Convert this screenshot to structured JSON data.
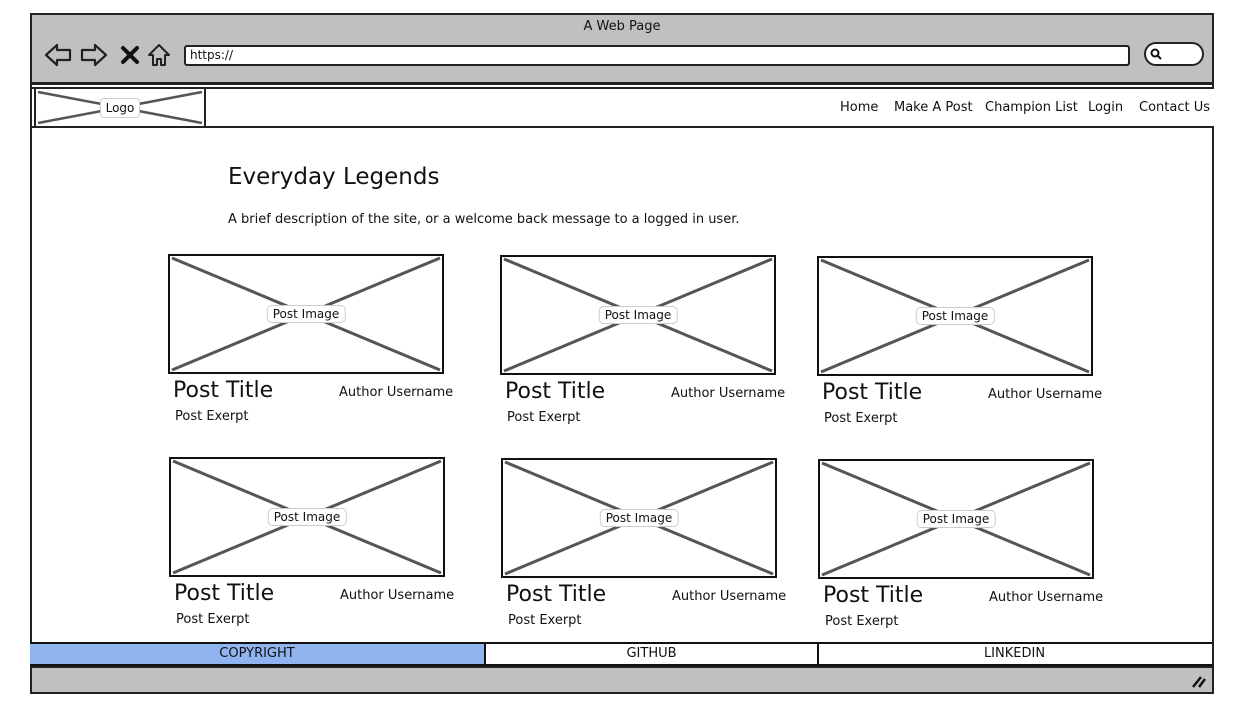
{
  "window": {
    "title": "A Web Page"
  },
  "browser": {
    "back_icon": "back-arrow-icon",
    "forward_icon": "forward-arrow-icon",
    "stop_icon": "close-icon",
    "home_icon": "home-icon",
    "url": "https://",
    "search_icon": "search-icon",
    "chrome_color": "#c0c0c0"
  },
  "header": {
    "logo_label": "Logo",
    "nav": [
      "Home",
      "Make A Post",
      "Champion List",
      "Login",
      "Contact Us"
    ]
  },
  "main": {
    "title": "Everyday Legends",
    "description": "A brief description of the site, or a welcome back message to a logged in user."
  },
  "posts": [
    {
      "image_label": "Post Image",
      "title": "Post Title",
      "author": "Author Username",
      "excerpt": "Post Exerpt"
    },
    {
      "image_label": "Post Image",
      "title": "Post Title",
      "author": "Author Username",
      "excerpt": "Post Exerpt"
    },
    {
      "image_label": "Post Image",
      "title": "Post Title",
      "author": "Author Username",
      "excerpt": "Post Exerpt"
    },
    {
      "image_label": "Post Image",
      "title": "Post Title",
      "author": "Author Username",
      "excerpt": "Post Exerpt"
    },
    {
      "image_label": "Post Image",
      "title": "Post Title",
      "author": "Author Username",
      "excerpt": "Post Exerpt"
    },
    {
      "image_label": "Post Image",
      "title": "Post Title",
      "author": "Author Username",
      "excerpt": "Post Exerpt"
    }
  ],
  "footer": {
    "items": [
      "COPYRIGHT",
      "GITHUB",
      "LINKEDIN"
    ],
    "active_color": "#8fb4f0"
  },
  "status_bar": {
    "resize_icon": "resize-grip-icon"
  }
}
